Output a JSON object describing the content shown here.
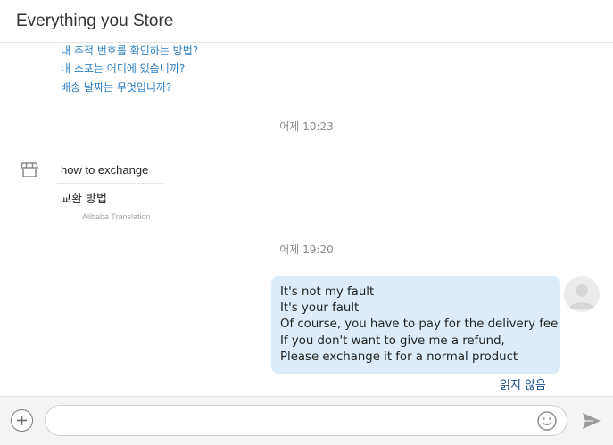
{
  "header": {
    "title": "Everything you Store"
  },
  "faq_links": [
    "내 추적 번호를 확인하는 방법?",
    "내 소포는 어디에 있습니까?",
    "배송 날짜는 무엇입니까?"
  ],
  "timestamps": [
    "어제 10:23",
    "어제 19:20"
  ],
  "incoming_message": {
    "text": "how to exchange",
    "translation": "교환 방법",
    "translation_source": "Alibaba Translation"
  },
  "outgoing_message": {
    "lines": [
      "It's not my fault",
      "It's your fault",
      "Of course, you have to pay for the delivery fee",
      "If you don't want to give me a refund,",
      "Please exchange it for a normal product"
    ],
    "status": "읽지 않음"
  },
  "composer": {
    "value": "",
    "placeholder": ""
  },
  "icons": {
    "store": "store-icon",
    "avatar": "user-avatar-icon",
    "plus": "plus-icon",
    "emoji": "smiley-icon",
    "send": "send-icon"
  },
  "colors": {
    "link": "#2f7fc1",
    "bubble": "#ddecfb",
    "status": "#1a4f8f"
  }
}
